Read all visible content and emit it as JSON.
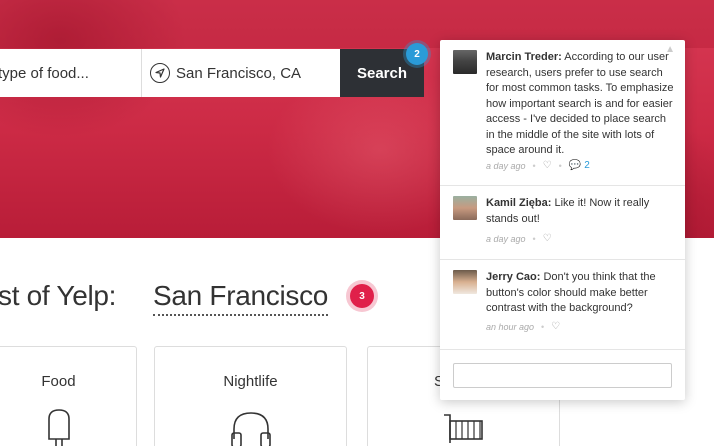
{
  "search": {
    "what_value": "type of food...",
    "where_value": "San Francisco, CA",
    "button_label": "Search",
    "pin_number": "2"
  },
  "heading": {
    "prefix": "st of Yelp:",
    "city": "San Francisco",
    "pin_number": "3"
  },
  "categories": [
    {
      "label": "Food",
      "icon": "popsicle-icon"
    },
    {
      "label": "Nightlife",
      "icon": "headphones-icon"
    },
    {
      "label": "S",
      "icon": "shopping-cart-icon"
    }
  ],
  "comments": [
    {
      "author": "Marcin Treder:",
      "text": "According to our user research, users prefer to use search for most common tasks. To emphasize how important search is and for easier access - I've decided to place search in the middle of the site with lots of space around it.",
      "time": "a day ago",
      "replies": "2"
    },
    {
      "author": "Kamil Zięba:",
      "text": "Like it! Now it really stands out!",
      "time": "a day ago"
    },
    {
      "author": "Jerry Cao:",
      "text": "Don't you think that the button's color should make better contrast with the background?",
      "time": "an hour ago"
    }
  ],
  "colors": {
    "hero": "#cc2a45",
    "search_button": "#2d3035",
    "pin_blue": "#2a9bd8",
    "pin_red": "#e0204a"
  }
}
